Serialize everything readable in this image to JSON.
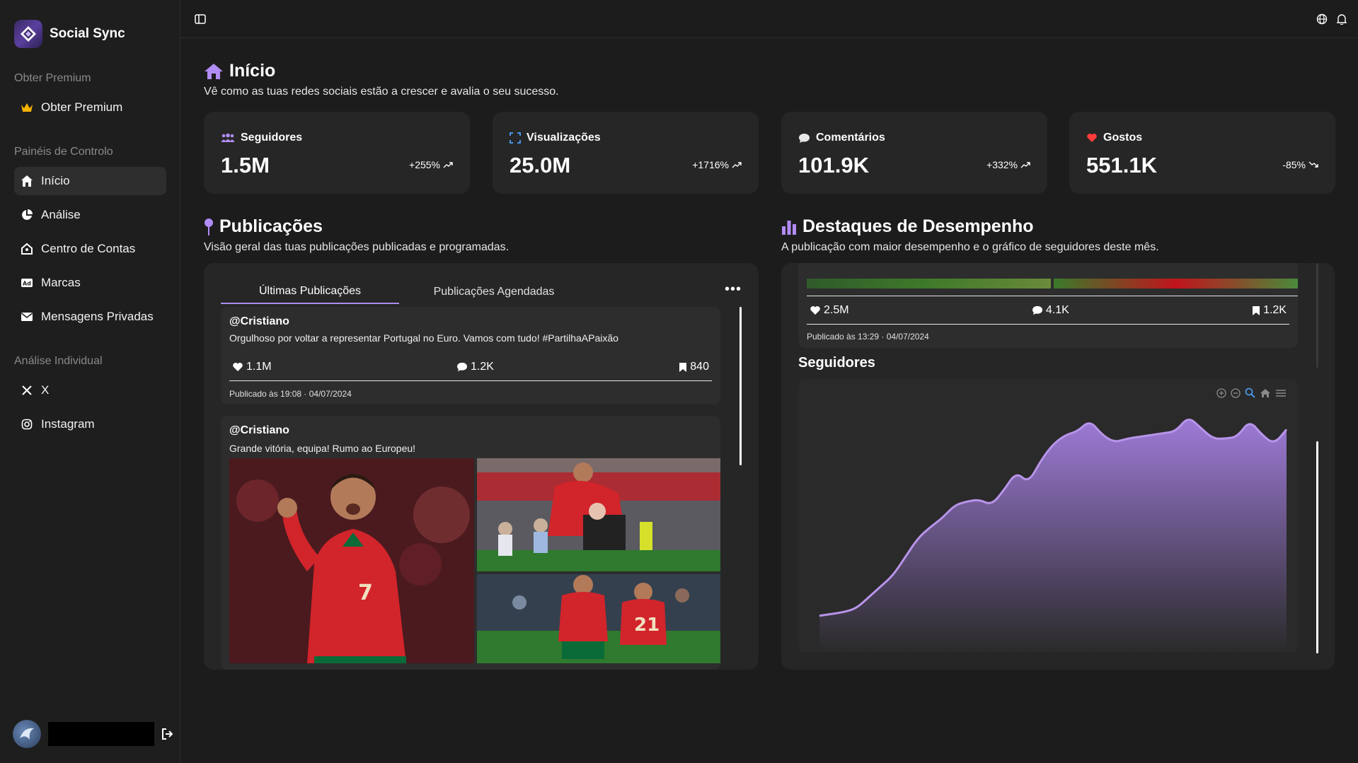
{
  "app": {
    "name": "Social Sync"
  },
  "sidebar": {
    "premium_title": "Obter Premium",
    "premium_item": "Obter Premium",
    "dash_title": "Painéis de Controlo",
    "dash_items": [
      "Início",
      "Análise",
      "Centro de Contas",
      "Marcas",
      "Mensagens Privadas"
    ],
    "individual_title": "Análise Individual",
    "individual_items": [
      "X",
      "Instagram"
    ]
  },
  "home": {
    "title": "Início",
    "subtitle": "Vê como as tuas redes sociais estão a crescer e avalia o seu sucesso."
  },
  "stats": [
    {
      "label": "Seguidores",
      "value": "1.5M",
      "change": "+255%",
      "trend": "up",
      "color": "#b18cf5"
    },
    {
      "label": "Visualizações",
      "value": "25.0M",
      "change": "+1716%",
      "trend": "up",
      "color": "#4aa3ff"
    },
    {
      "label": "Comentários",
      "value": "101.9K",
      "change": "+332%",
      "trend": "up",
      "color": "#e8e8e8"
    },
    {
      "label": "Gostos",
      "value": "551.1K",
      "change": "-85%",
      "trend": "down",
      "color": "#ff3b3b"
    }
  ],
  "posts_section": {
    "title": "Publicações",
    "subtitle": "Visão geral das tuas publicações publicadas e programadas.",
    "tabs": [
      "Últimas Publicações",
      "Publicações Agendadas"
    ],
    "more": "•••",
    "posts": [
      {
        "handle": "@Cristiano",
        "text": "Orgulhoso por voltar a representar Portugal no Euro. Vamos com tudo! #PartilhaAPaixão",
        "likes": "1.1M",
        "comments": "1.2K",
        "saves": "840",
        "published": "Publicado às 19:08 · 04/07/2024"
      },
      {
        "handle": "@Cristiano",
        "text": "Grande vitória, equipa! Rumo ao Europeu!"
      }
    ]
  },
  "highlights": {
    "title": "Destaques de Desempenho",
    "subtitle": "A publicação com maior desempenho e o gráfico de seguidores deste mês.",
    "top_post": {
      "likes": "2.5M",
      "comments": "4.1K",
      "saves": "1.2K",
      "published": "Publicado às 13:29 · 04/07/2024"
    },
    "followers_title": "Seguidores"
  },
  "chart_data": {
    "type": "area",
    "title": "Seguidores",
    "series": [
      {
        "values": [
          2,
          3,
          4,
          6,
          12,
          18,
          24,
          34,
          44,
          50,
          55,
          62,
          64,
          65,
          62,
          70,
          80,
          74,
          86,
          95,
          100,
          102,
          108,
          100,
          96,
          98,
          99,
          100,
          101,
          102,
          110,
          104,
          98,
          98,
          99,
          108,
          100,
          95,
          103
        ]
      }
    ],
    "color": "#9d7ad6",
    "grid": false
  }
}
